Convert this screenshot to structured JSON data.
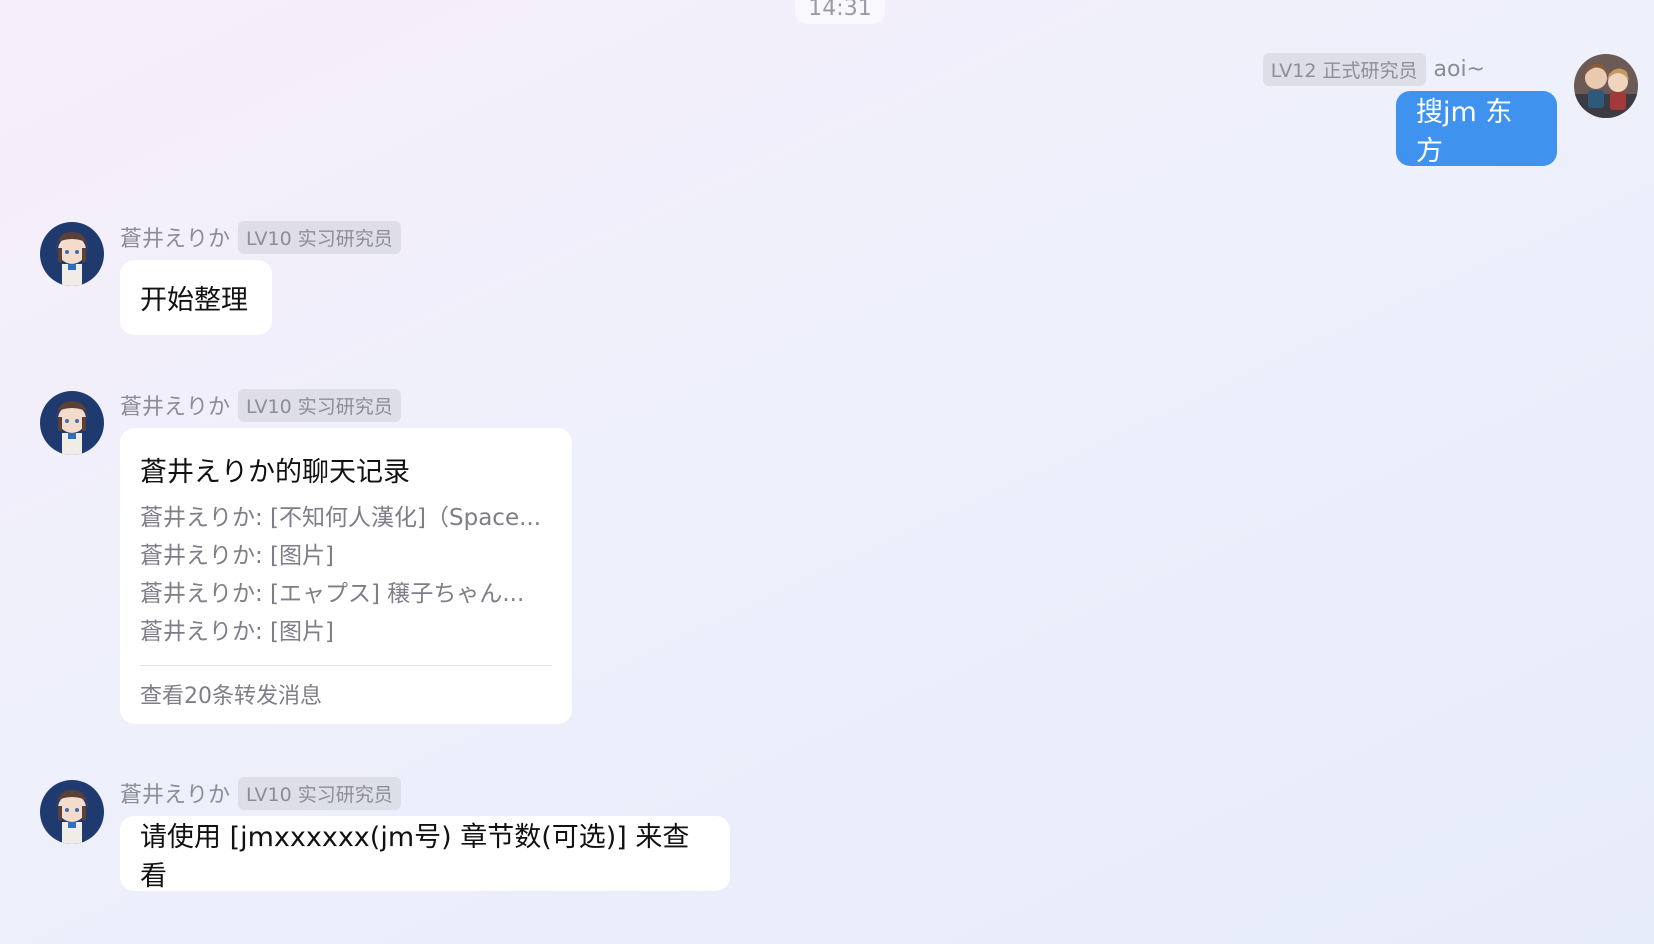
{
  "time": "14:31",
  "me": {
    "level": "LV12 正式研究员",
    "name": "aoi~",
    "message": "搜jm 东方"
  },
  "bot": {
    "name": "蒼井えりか",
    "level": "LV10 实习研究员"
  },
  "messages": {
    "m1": "开始整理",
    "forward": {
      "title": "蒼井えりか的聊天记录",
      "lines": [
        "蒼井えりか: [不知何人漢化]（Space...",
        "蒼井えりか: [图片]",
        "蒼井えりか: [エャプス] 穣子ちゃん...",
        "蒼井えりか: [图片]"
      ],
      "footer": "查看20条转发消息"
    },
    "m3": "请使用 [jmxxxxxx(jm号) 章节数(可选)] 来查看"
  },
  "colors": {
    "my_bubble": "#3f93ef",
    "bubble": "#ffffff",
    "muted_text": "#8c8c96"
  }
}
